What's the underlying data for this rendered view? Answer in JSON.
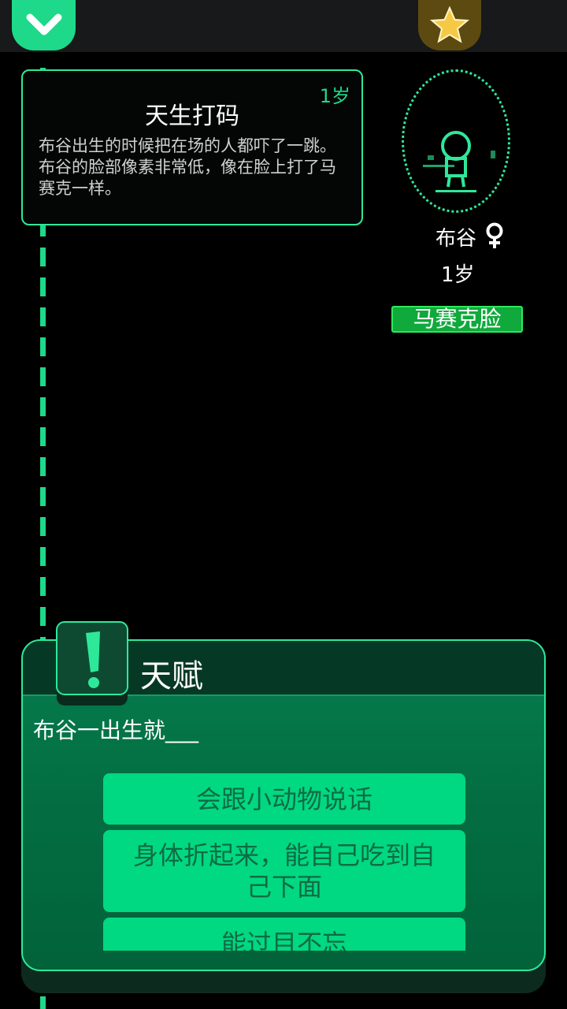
{
  "topbar": {
    "collapse_icon": "chevron-down-icon",
    "favorite_icon": "star-icon",
    "colors": {
      "collapse": "#1ed98a",
      "favorite": "#5c4a10"
    }
  },
  "event": {
    "age": "1岁",
    "title": "天生打码",
    "description": "布谷出生的时候把在场的人都吓了一跳。布谷的脸部像素非常低，像在脸上打了马赛克一样。"
  },
  "profile": {
    "name": "布谷",
    "gender_icon": "female-icon",
    "age": "1岁",
    "trait": "马赛克脸"
  },
  "talent": {
    "title": "天赋",
    "icon": "exclamation-icon",
    "prompt": "布谷一出生就___",
    "options": [
      {
        "label": "会跟小动物说话"
      },
      {
        "label": "身体折起来，能自己吃到自己下面"
      },
      {
        "label": "能过目不忘"
      }
    ]
  },
  "colors": {
    "accent": "#1ed98a",
    "panel": "#03603a",
    "option": "#00d882",
    "badge": "#10a93c"
  }
}
